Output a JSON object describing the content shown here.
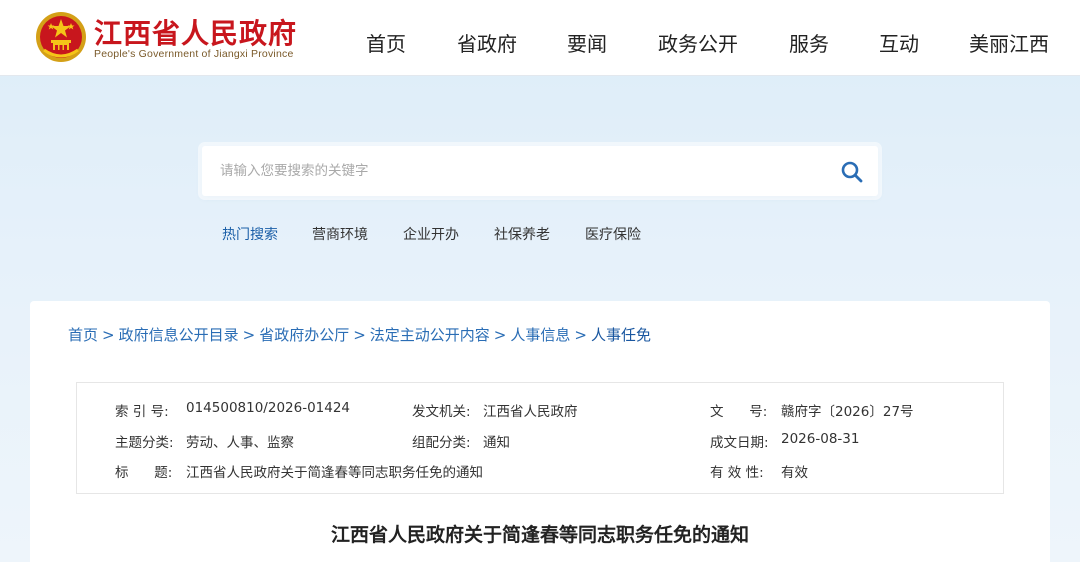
{
  "header": {
    "site_title": "江西省人民政府",
    "site_subtitle": "People's Government of Jiangxi Province",
    "nav": [
      "首页",
      "省政府",
      "要闻",
      "政务公开",
      "服务",
      "互动",
      "美丽江西"
    ]
  },
  "search": {
    "placeholder": "请输入您要搜索的关键字",
    "hot_label": "热门搜索",
    "hot_items": [
      "营商环境",
      "企业开办",
      "社保养老",
      "医疗保险"
    ]
  },
  "breadcrumb": [
    "首页",
    "政府信息公开目录",
    "省政府办公厅",
    "法定主动公开内容",
    "人事信息",
    "人事任免"
  ],
  "meta": {
    "index_label": "索 引 号:",
    "index_value": "014500810/2026-01424",
    "issuer_label": "发文机关:",
    "issuer_value": "江西省人民政府",
    "docno_label": "文      号:",
    "docno_value": "赣府字〔2026〕27号",
    "topic_label": "主题分类:",
    "topic_value": "劳动、人事、监察",
    "form_label": "组配分类:",
    "form_value": "通知",
    "date_label": "成文日期:",
    "date_value": "2026-08-31",
    "title_label": "标      题:",
    "title_value": "江西省人民政府关于简逢春等同志职务任免的通知",
    "valid_label": "有 效 性:",
    "valid_value": "有效"
  },
  "document": {
    "title": "江西省人民政府关于简逢春等同志职务任免的通知"
  },
  "colors": {
    "brand_red": "#c8161d",
    "link_blue": "#2a6db5",
    "search_icon": "#2a6db5"
  }
}
